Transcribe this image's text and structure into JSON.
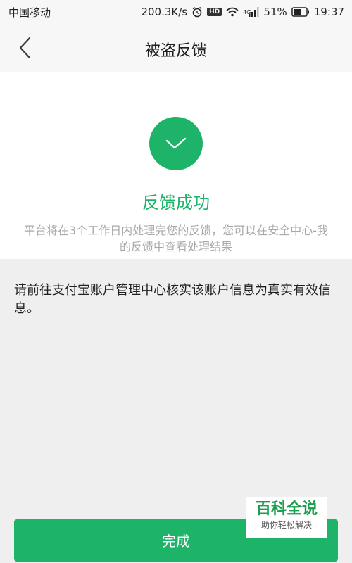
{
  "status_bar": {
    "carrier": "中国移动",
    "net_speed": "200.3K/s",
    "hd_label": "HD",
    "network_type": "4G",
    "battery_percent": "51%",
    "time": "19:37",
    "icons": [
      "alarm-icon",
      "hd-icon",
      "wifi-icon",
      "signal-icon",
      "battery-icon"
    ]
  },
  "header": {
    "title": "被盗反馈",
    "back_icon": "back-arrow-icon"
  },
  "success": {
    "icon": "check-icon",
    "title": "反馈成功",
    "description": "平台将在3个工作日内处理完您的反馈，您可以在安全中心-我的反馈中查看处理结果"
  },
  "info": {
    "text": "请前往支付宝账户管理中心核实该账户信息为真实有效信息。"
  },
  "done_button": {
    "label": "完成"
  },
  "watermark": {
    "title": "百科全说",
    "subtitle": "助你轻松解决"
  },
  "colors": {
    "accent": "#1db369",
    "page_bg": "#efefef",
    "header_bg": "#f7f7f7",
    "desc_text": "#a8a8a8"
  }
}
